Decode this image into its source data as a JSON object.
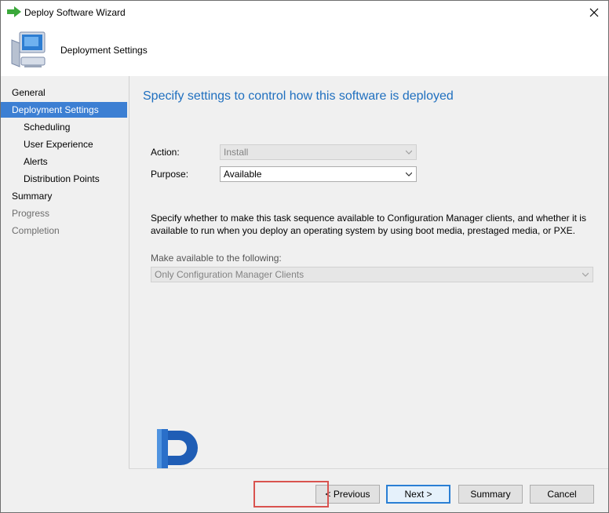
{
  "window": {
    "title": "Deploy Software Wizard"
  },
  "header": {
    "title": "Deployment Settings"
  },
  "nav": {
    "items": [
      {
        "label": "General",
        "state": "normal"
      },
      {
        "label": "Deployment Settings",
        "state": "selected"
      },
      {
        "label": "Scheduling",
        "state": "normal"
      },
      {
        "label": "User Experience",
        "state": "normal"
      },
      {
        "label": "Alerts",
        "state": "normal"
      },
      {
        "label": "Distribution Points",
        "state": "normal"
      },
      {
        "label": "Summary",
        "state": "normal"
      },
      {
        "label": "Progress",
        "state": "disabled"
      },
      {
        "label": "Completion",
        "state": "disabled"
      }
    ]
  },
  "main": {
    "heading": "Specify settings to control how this software is deployed",
    "action": {
      "label": "Action:",
      "value": "Install",
      "disabled": true
    },
    "purpose": {
      "label": "Purpose:",
      "value": "Available",
      "disabled": false
    },
    "description": "Specify whether to make this task sequence available to Configuration Manager clients, and whether it is available to run when you deploy an operating system by using boot media, prestaged media, or PXE.",
    "make_available": {
      "label": "Make available to the following:",
      "value": "Only Configuration Manager Clients",
      "disabled": true
    }
  },
  "footer": {
    "previous_label": "< Previous",
    "next_label": "Next >",
    "summary_label": "Summary",
    "cancel_label": "Cancel"
  },
  "icons": {
    "title": "green-arrow-icon",
    "header": "computer-icon",
    "close": "close-icon",
    "logo": "brand-logo-icon"
  },
  "colors": {
    "accent": "#3c7fd3",
    "heading": "#1f6fbf",
    "highlight": "#d9534f"
  }
}
